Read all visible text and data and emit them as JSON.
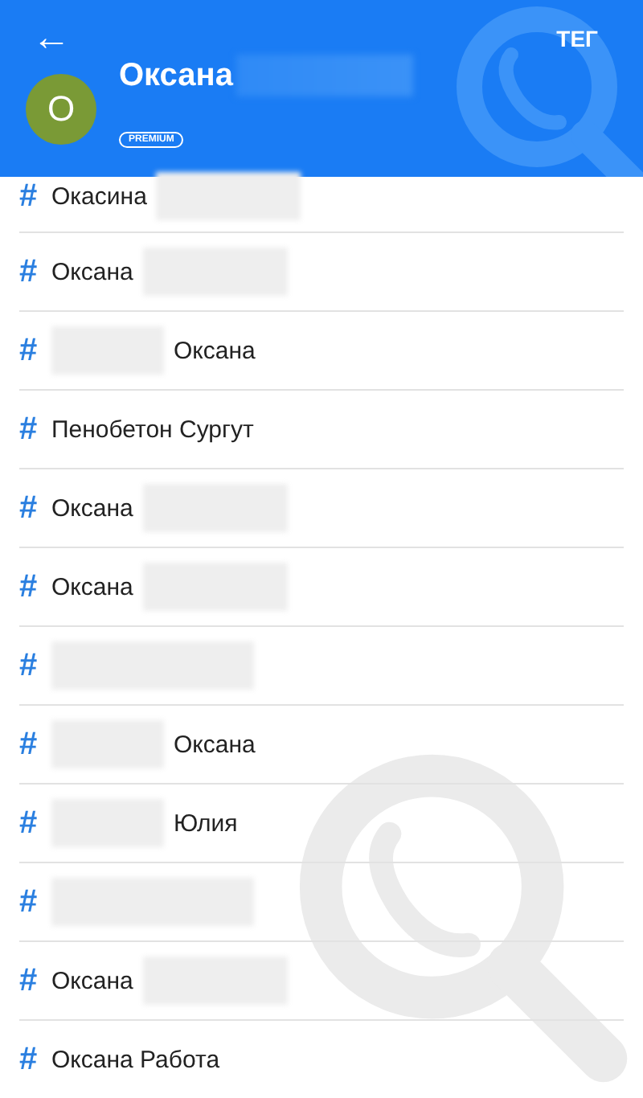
{
  "header": {
    "back": "←",
    "action": "ТЕГ",
    "avatar_letter": "О",
    "name_parts": [
      {
        "kind": "text",
        "text": "Оксана"
      },
      {
        "kind": "redacted"
      }
    ],
    "badge": "PREMIUM"
  },
  "tags": [
    {
      "symbol": "#",
      "parts": [
        {
          "kind": "text",
          "text": "Окасина"
        },
        {
          "kind": "redacted"
        }
      ]
    },
    {
      "symbol": "#",
      "parts": [
        {
          "kind": "text",
          "text": "Оксана"
        },
        {
          "kind": "redacted"
        }
      ]
    },
    {
      "symbol": "#",
      "parts": [
        {
          "kind": "redacted"
        },
        {
          "kind": "text",
          "text": "Оксана"
        }
      ]
    },
    {
      "symbol": "#",
      "parts": [
        {
          "kind": "text",
          "text": "Пенобетон Сургут"
        }
      ]
    },
    {
      "symbol": "#",
      "parts": [
        {
          "kind": "text",
          "text": "Оксана"
        },
        {
          "kind": "redacted"
        }
      ]
    },
    {
      "symbol": "#",
      "parts": [
        {
          "kind": "text",
          "text": "Оксана"
        },
        {
          "kind": "redacted"
        }
      ]
    },
    {
      "symbol": "#",
      "parts": [
        {
          "kind": "redacted"
        }
      ]
    },
    {
      "symbol": "#",
      "parts": [
        {
          "kind": "redacted"
        },
        {
          "kind": "text",
          "text": "Оксана"
        }
      ]
    },
    {
      "symbol": "#",
      "parts": [
        {
          "kind": "redacted"
        },
        {
          "kind": "text",
          "text": "Юлия"
        }
      ]
    },
    {
      "symbol": "#",
      "parts": [
        {
          "kind": "redacted"
        }
      ]
    },
    {
      "symbol": "#",
      "parts": [
        {
          "kind": "text",
          "text": "Оксана"
        },
        {
          "kind": "redacted"
        }
      ]
    },
    {
      "symbol": "#",
      "parts": [
        {
          "kind": "text",
          "text": "Оксана Работа"
        }
      ]
    }
  ]
}
